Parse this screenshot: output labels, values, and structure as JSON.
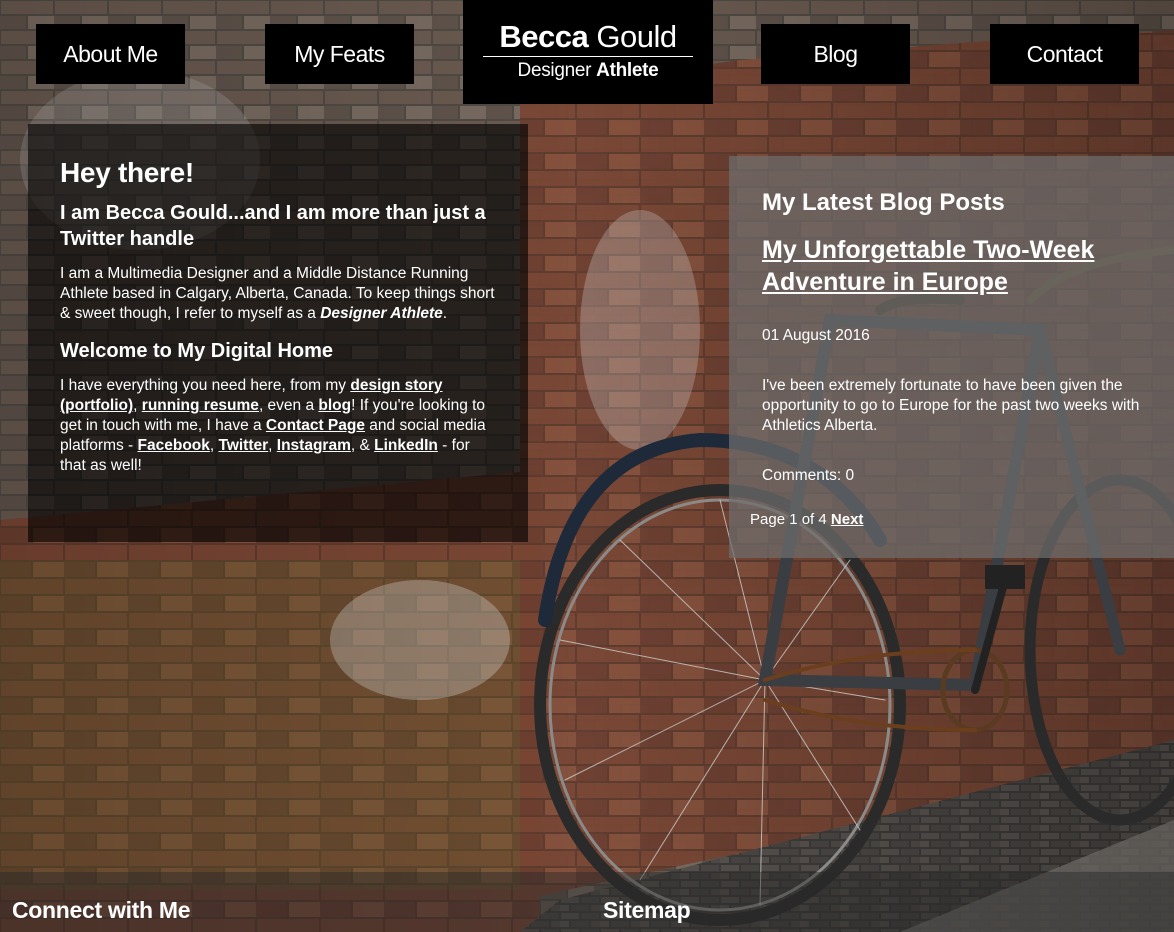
{
  "nav": {
    "about_label": "About Me",
    "feats_label": "My Feats",
    "blog_label": "Blog",
    "contact_label": "Contact"
  },
  "logo": {
    "first_name": "Becca",
    "last_name": "Gould",
    "tag_first": "Designer",
    "tag_second": "Athlete"
  },
  "intro": {
    "greeting": "Hey there!",
    "headline": "I am Becca Gould...and I am more than just a Twitter handle",
    "para1_text": "I am a Multimedia Designer and a Middle Distance Running Athlete based in Calgary, Alberta, Canada. To keep things short & sweet though, I refer to myself as a ",
    "para1_em": "Designer Athlete",
    "para1_end": ".",
    "welcome_heading": "Welcome to My Digital Home",
    "para2": {
      "t1": "I have everything you need here, from my ",
      "link_design_story": "design story (portfolio)",
      "t2": ", ",
      "link_running_resume": "running resume",
      "t3": ", even a ",
      "link_blog": "blog",
      "t4": "! If you're looking to get in touch with me, I have a ",
      "link_contact": "Contact Page",
      "t5": " and social media platforms - ",
      "link_facebook": "Facebook",
      "t6": ", ",
      "link_twitter": "Twitter",
      "t7": ", ",
      "link_instagram": "Instagram",
      "t8": ", & ",
      "link_linkedin": "LinkedIn",
      "t9": " - for that as well!"
    }
  },
  "blog": {
    "heading": "My Latest Blog Posts",
    "post_title": "My Unforgettable Two-Week Adventure in Europe",
    "post_date": "01 August 2016",
    "post_excerpt": "I've been extremely fortunate to have been given the opportunity to go to Europe for the past two weeks with Athletics Alberta.",
    "post_comments": "Comments: 0",
    "pager_text": "Page 1 of 4",
    "pager_next": "Next"
  },
  "footer": {
    "connect_heading": "Connect with Me",
    "sitemap_heading": "Sitemap"
  },
  "colors": {
    "nav_bg": "#000000",
    "intro_panel": "rgba(0,0,0,0.62)",
    "blog_panel": "rgba(110,110,110,0.72)",
    "text": "#ffffff"
  }
}
